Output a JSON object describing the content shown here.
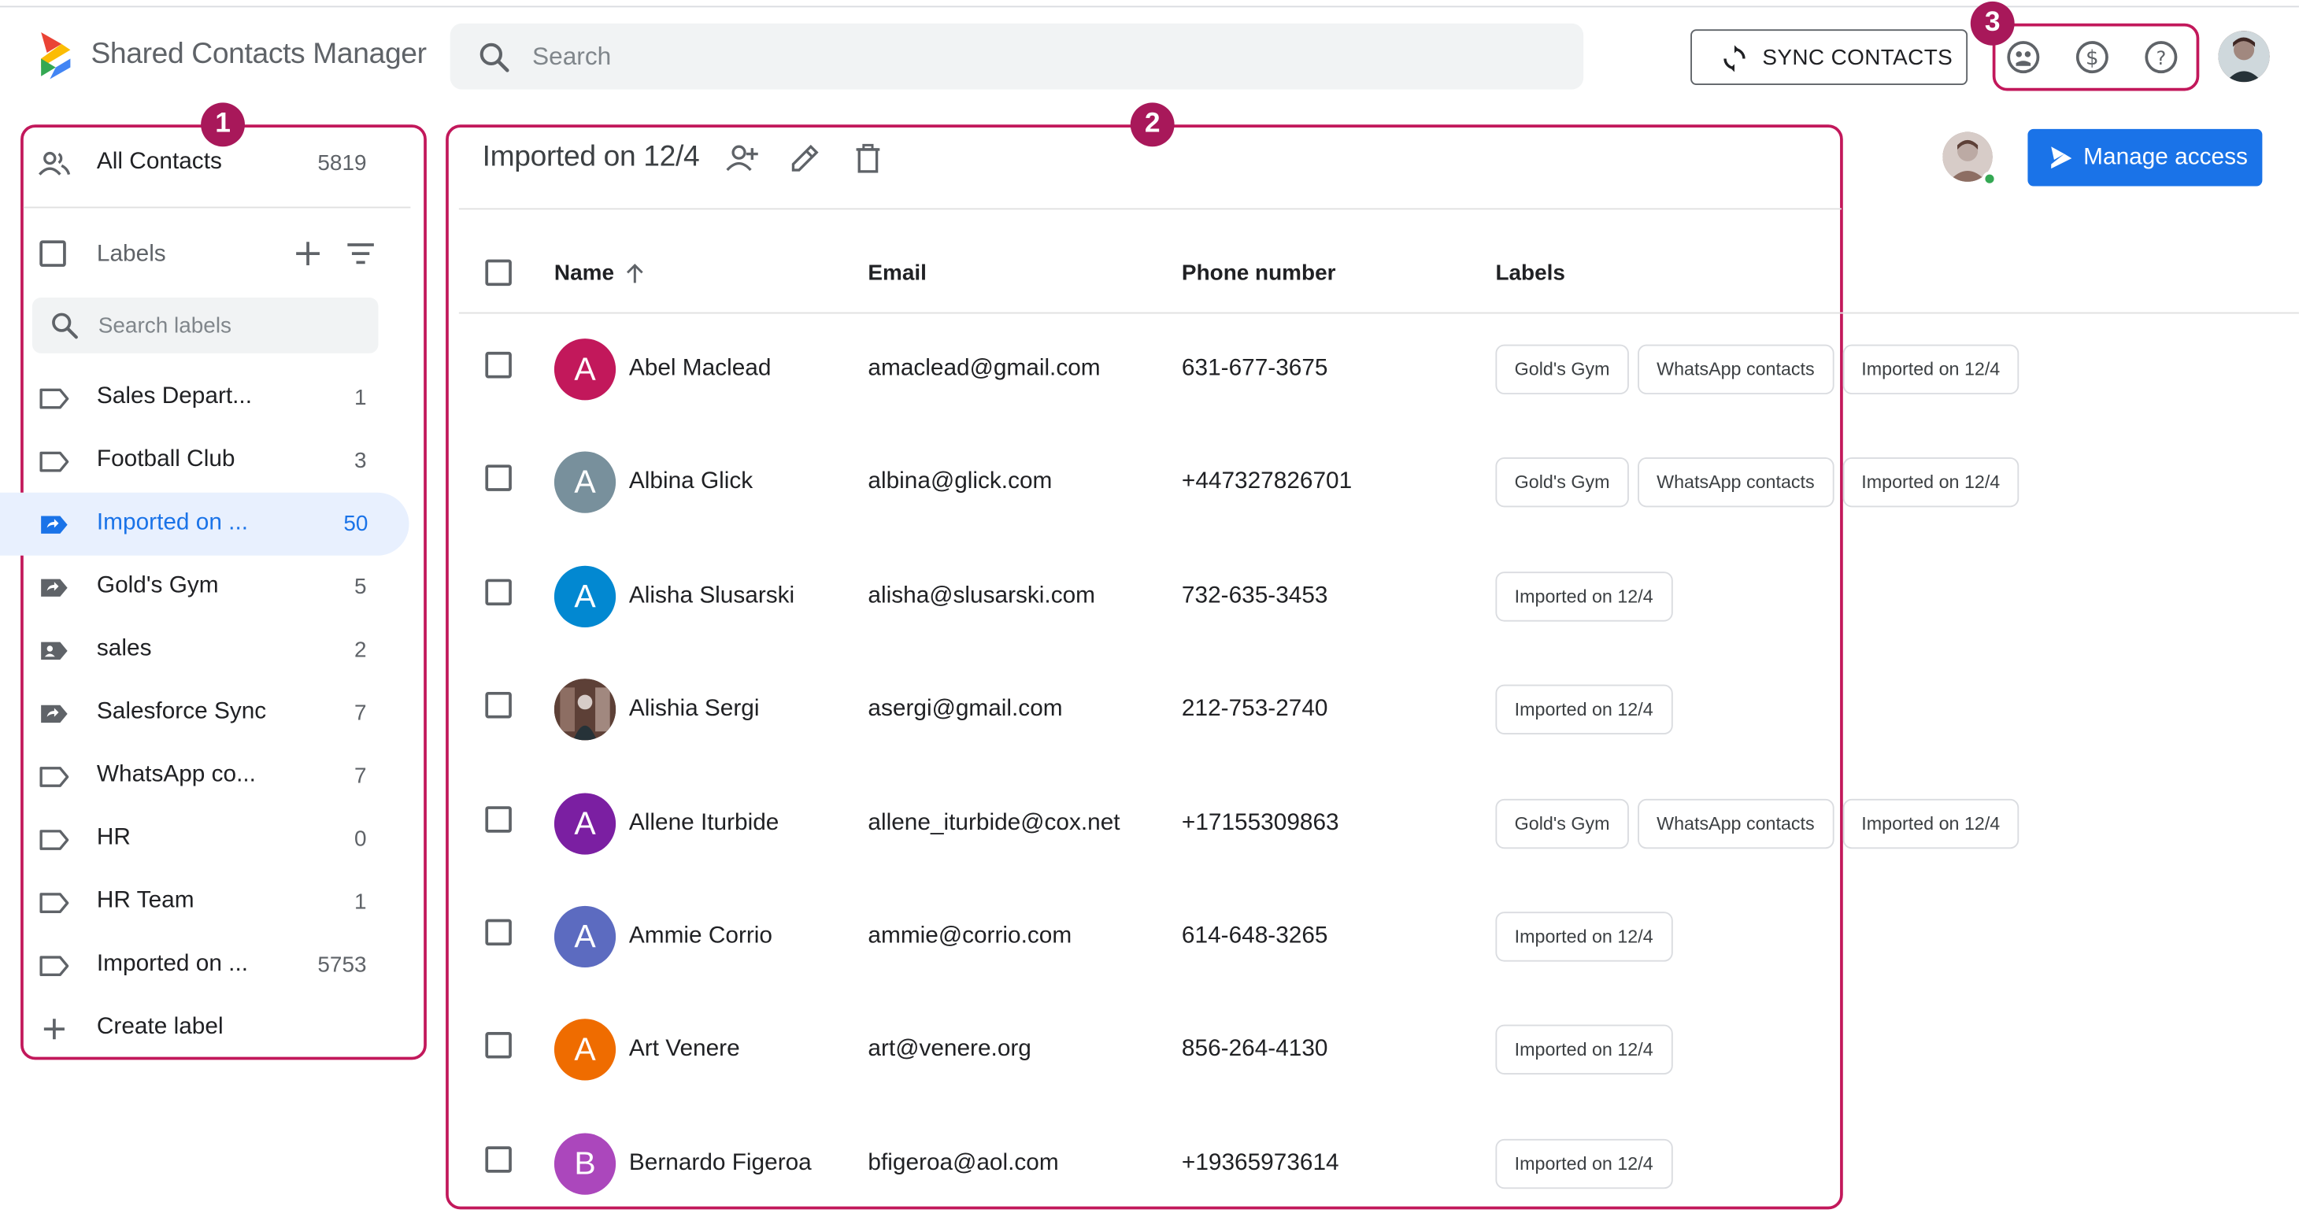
{
  "app": {
    "title": "Shared Contacts Manager"
  },
  "search": {
    "placeholder": "Search"
  },
  "toolbar": {
    "sync_label": "SYNC CONTACTS"
  },
  "badges": [
    "1",
    "2",
    "3"
  ],
  "sidebar": {
    "all_contacts": {
      "label": "All Contacts",
      "count": "5819"
    },
    "labels_title": "Labels",
    "search_placeholder": "Search labels",
    "items": [
      {
        "label": "Sales Depart...",
        "count": "1",
        "icon": "label-outline-icon"
      },
      {
        "label": "Football Club",
        "count": "3",
        "icon": "label-outline-icon"
      },
      {
        "label": "Imported on ...",
        "count": "50",
        "icon": "shared-label-icon",
        "active": true
      },
      {
        "label": "Gold's Gym",
        "count": "5",
        "icon": "shared-label-icon"
      },
      {
        "label": "sales",
        "count": "2",
        "icon": "contact-label-icon"
      },
      {
        "label": "Salesforce Sync",
        "count": "7",
        "icon": "shared-label-icon"
      },
      {
        "label": "WhatsApp co...",
        "count": "7",
        "icon": "label-outline-icon"
      },
      {
        "label": "HR",
        "count": "0",
        "icon": "label-outline-icon"
      },
      {
        "label": "HR Team",
        "count": "1",
        "icon": "label-outline-icon"
      },
      {
        "label": "Imported on ...",
        "count": "5753",
        "icon": "label-outline-icon"
      }
    ],
    "create_label": "Create label"
  },
  "main": {
    "title": "Imported on 12/4",
    "manage_access": "Manage access",
    "columns": {
      "name": "Name",
      "email": "Email",
      "phone": "Phone number",
      "labels": "Labels"
    },
    "rows": [
      {
        "initial": "A",
        "color": "#c2185b",
        "name": "Abel Maclead",
        "email": "amaclead@gmail.com",
        "phone": "631-677-3675",
        "labels": [
          "Gold's Gym",
          "WhatsApp contacts",
          "Imported on 12/4"
        ]
      },
      {
        "initial": "A",
        "color": "#78909c",
        "name": "Albina Glick",
        "email": "albina@glick.com",
        "phone": "+447327826701",
        "labels": [
          "Gold's Gym",
          "WhatsApp contacts",
          "Imported on 12/4"
        ]
      },
      {
        "initial": "A",
        "color": "#0288d1",
        "name": "Alisha Slusarski",
        "email": "alisha@slusarski.com",
        "phone": "732-635-3453",
        "labels": [
          "Imported on 12/4"
        ]
      },
      {
        "initial": "",
        "color": "#6d4c41",
        "photo": true,
        "name": "Alishia Sergi",
        "email": "asergi@gmail.com",
        "phone": "212-753-2740",
        "labels": [
          "Imported on 12/4"
        ]
      },
      {
        "initial": "A",
        "color": "#7b1fa2",
        "name": "Allene Iturbide",
        "email": "allene_iturbide@cox.net",
        "phone": "+17155309863",
        "labels": [
          "Gold's Gym",
          "WhatsApp contacts",
          "Imported on 12/4"
        ]
      },
      {
        "initial": "A",
        "color": "#5c6bc0",
        "name": "Ammie Corrio",
        "email": "ammie@corrio.com",
        "phone": "614-648-3265",
        "labels": [
          "Imported on 12/4"
        ]
      },
      {
        "initial": "A",
        "color": "#ef6c00",
        "name": "Art Venere",
        "email": "art@venere.org",
        "phone": "856-264-4130",
        "labels": [
          "Imported on 12/4"
        ]
      },
      {
        "initial": "B",
        "color": "#ab47bc",
        "name": "Bernardo Figeroa",
        "email": "bfigeroa@aol.com",
        "phone": "+19365973614",
        "labels": [
          "Imported on 12/4"
        ]
      }
    ]
  }
}
